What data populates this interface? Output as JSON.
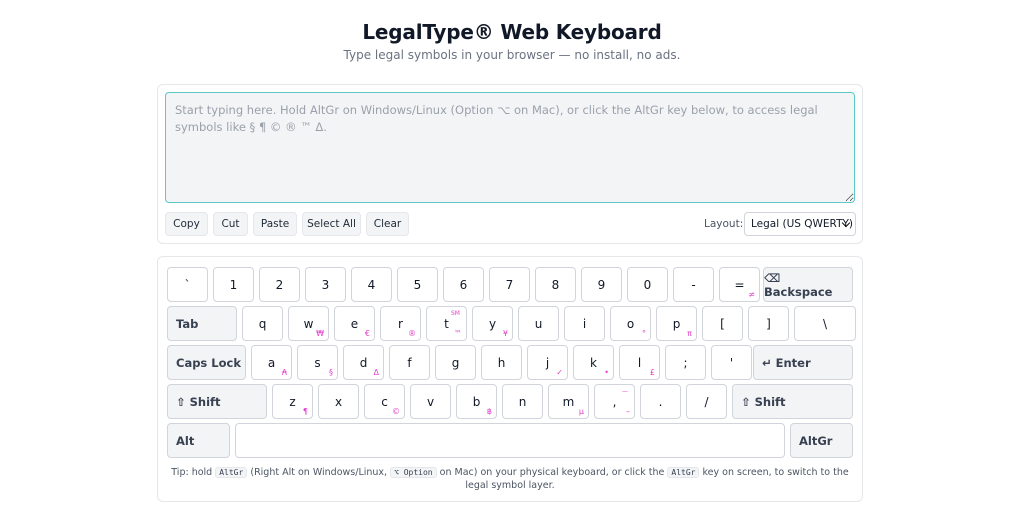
{
  "header": {
    "title": "LegalType® Web Keyboard",
    "subtitle": "Type legal symbols in your browser — no install, no ads."
  },
  "editor": {
    "placeholder": "Start typing here. Hold AltGr on Windows/Linux (Option ⌥ on Mac), or click the AltGr key below, to access legal symbols like § ¶ © ® ™ Δ.",
    "value": ""
  },
  "toolbar": {
    "copy": "Copy",
    "cut": "Cut",
    "paste": "Paste",
    "select_all": "Select All",
    "clear": "Clear",
    "layout_label": "Layout:",
    "layout_value": "Legal (US QWERTY)"
  },
  "keyboard": {
    "row1": [
      {
        "k": "`",
        "alt": ""
      },
      {
        "k": "1",
        "alt": ""
      },
      {
        "k": "2",
        "alt": ""
      },
      {
        "k": "3",
        "alt": ""
      },
      {
        "k": "4",
        "alt": ""
      },
      {
        "k": "5",
        "alt": ""
      },
      {
        "k": "6",
        "alt": ""
      },
      {
        "k": "7",
        "alt": ""
      },
      {
        "k": "8",
        "alt": ""
      },
      {
        "k": "9",
        "alt": ""
      },
      {
        "k": "0",
        "alt": ""
      },
      {
        "k": "-",
        "alt": ""
      },
      {
        "k": "=",
        "alt": "≠"
      }
    ],
    "backspace": "⌫ Backspace",
    "tab": "Tab",
    "row2": [
      {
        "k": "q",
        "alt": ""
      },
      {
        "k": "w",
        "alt": "₩"
      },
      {
        "k": "e",
        "alt": "€"
      },
      {
        "k": "r",
        "alt": "®"
      },
      {
        "k": "t",
        "alt": "™"
      },
      {
        "k": "y",
        "alt": "¥"
      },
      {
        "k": "u",
        "alt": ""
      },
      {
        "k": "i",
        "alt": ""
      },
      {
        "k": "o",
        "alt": "°"
      },
      {
        "k": "p",
        "alt": "π"
      },
      {
        "k": "[",
        "alt": ""
      },
      {
        "k": "]",
        "alt": ""
      },
      {
        "k": "\\",
        "alt": ""
      }
    ],
    "t_top_alt": "SM",
    "caps_lock": "Caps Lock",
    "row3": [
      {
        "k": "a",
        "alt": "₳"
      },
      {
        "k": "s",
        "alt": "§"
      },
      {
        "k": "d",
        "alt": "Δ"
      },
      {
        "k": "f",
        "alt": ""
      },
      {
        "k": "g",
        "alt": ""
      },
      {
        "k": "h",
        "alt": ""
      },
      {
        "k": "j",
        "alt": "✓"
      },
      {
        "k": "k",
        "alt": "•"
      },
      {
        "k": "l",
        "alt": "£"
      },
      {
        "k": ";",
        "alt": ""
      },
      {
        "k": "'",
        "alt": ""
      }
    ],
    "enter": "↵ Enter",
    "shift_left": "⇧ Shift",
    "row4": [
      {
        "k": "z",
        "alt": "¶"
      },
      {
        "k": "x",
        "alt": ""
      },
      {
        "k": "c",
        "alt": "©"
      },
      {
        "k": "v",
        "alt": ""
      },
      {
        "k": "b",
        "alt": "฿"
      },
      {
        "k": "n",
        "alt": ""
      },
      {
        "k": "m",
        "alt": "µ"
      },
      {
        "k": ",",
        "alt": "–"
      },
      {
        "k": ".",
        "alt": ""
      },
      {
        "k": "/",
        "alt": ""
      }
    ],
    "comma_top_alt": "—",
    "shift_right": "⇧ Shift",
    "alt": "Alt",
    "altgr": "AltGr"
  },
  "tip": {
    "part1": "Tip: hold",
    "code1": "AltGr",
    "part2": "(Right Alt on Windows/Linux,",
    "code2": "⌥ Option",
    "part3": "on Mac) on your physical keyboard, or click the",
    "code3": "AltGr",
    "part4": "key on screen, to switch to the legal symbol layer."
  },
  "colors": {
    "accent": "#5ec8c8",
    "alt_symbol": "#e040c8"
  }
}
